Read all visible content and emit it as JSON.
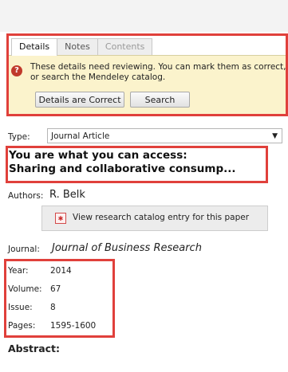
{
  "tabs": [
    {
      "label": "Details",
      "state": "active"
    },
    {
      "label": "Notes",
      "state": "normal"
    },
    {
      "label": "Contents",
      "state": "disabled"
    }
  ],
  "review": {
    "icon": "warning-icon",
    "message": "These details need reviewing. You can mark them as correct, or search the Mendeley catalog.",
    "correct_button": "Details are Correct",
    "search_button": "Search"
  },
  "type": {
    "label": "Type:",
    "value": "Journal Article"
  },
  "document": {
    "title_line1": "You are what you can access:",
    "title_line2": "Sharing and collaborative consump..."
  },
  "authors": {
    "label": "Authors:",
    "value": "R. Belk"
  },
  "catalog": {
    "label": "View research catalog entry for this paper",
    "icon": "mendeley-icon"
  },
  "journal": {
    "label": "Journal:",
    "value": "Journal of Business Research"
  },
  "fields": {
    "year": {
      "label": "Year:",
      "value": "2014"
    },
    "volume": {
      "label": "Volume:",
      "value": "67"
    },
    "issue": {
      "label": "Issue:",
      "value": "8"
    },
    "pages": {
      "label": "Pages:",
      "value": "1595-1600"
    }
  },
  "abstract": {
    "label": "Abstract:"
  },
  "colors": {
    "highlight": "#e0403b",
    "review_bg": "#fbf3cc"
  }
}
